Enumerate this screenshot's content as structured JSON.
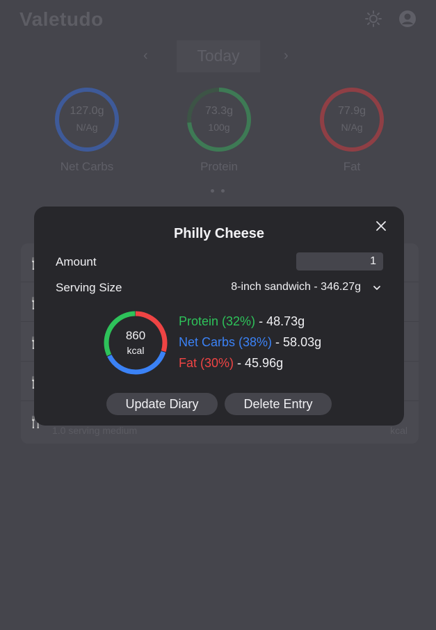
{
  "app": {
    "brand": "Valetudo"
  },
  "header": {
    "icons": [
      "sun-icon",
      "user-icon"
    ]
  },
  "date_nav": {
    "label": "Today"
  },
  "summary": {
    "rings": [
      {
        "value": "127.0g",
        "goal": "N/Ag",
        "label": "Net Carbs",
        "color": "#3e5a99",
        "fraction": 1.0
      },
      {
        "value": "73.3g",
        "goal": "100g",
        "label": "Protein",
        "color": "#3e7a55",
        "fraction": 0.733
      },
      {
        "value": "77.9g",
        "goal": "N/Ag",
        "label": "Fat",
        "color": "#8f3f45",
        "fraction": 1.0
      }
    ]
  },
  "diary": {
    "last_row_sub": "1.0 serving medium",
    "last_row_kcal": "kcal"
  },
  "modal": {
    "title": "Philly Cheese",
    "amount_label": "Amount",
    "amount_value": "1",
    "serving_label": "Serving Size",
    "serving_value": "8-inch sandwich - 346.27g",
    "kcal": "860",
    "kcal_unit": "kcal",
    "macros": [
      {
        "name": "Protein (32%)",
        "grams": "48.73g",
        "color": "#2ec25a",
        "percent": 32
      },
      {
        "name": "Net Carbs (38%)",
        "grams": "58.03g",
        "color": "#3b82f6",
        "percent": 38
      },
      {
        "name": "Fat (30%)",
        "grams": "45.96g",
        "color": "#ef4444",
        "percent": 30
      }
    ],
    "update_label": "Update Diary",
    "delete_label": "Delete Entry"
  }
}
